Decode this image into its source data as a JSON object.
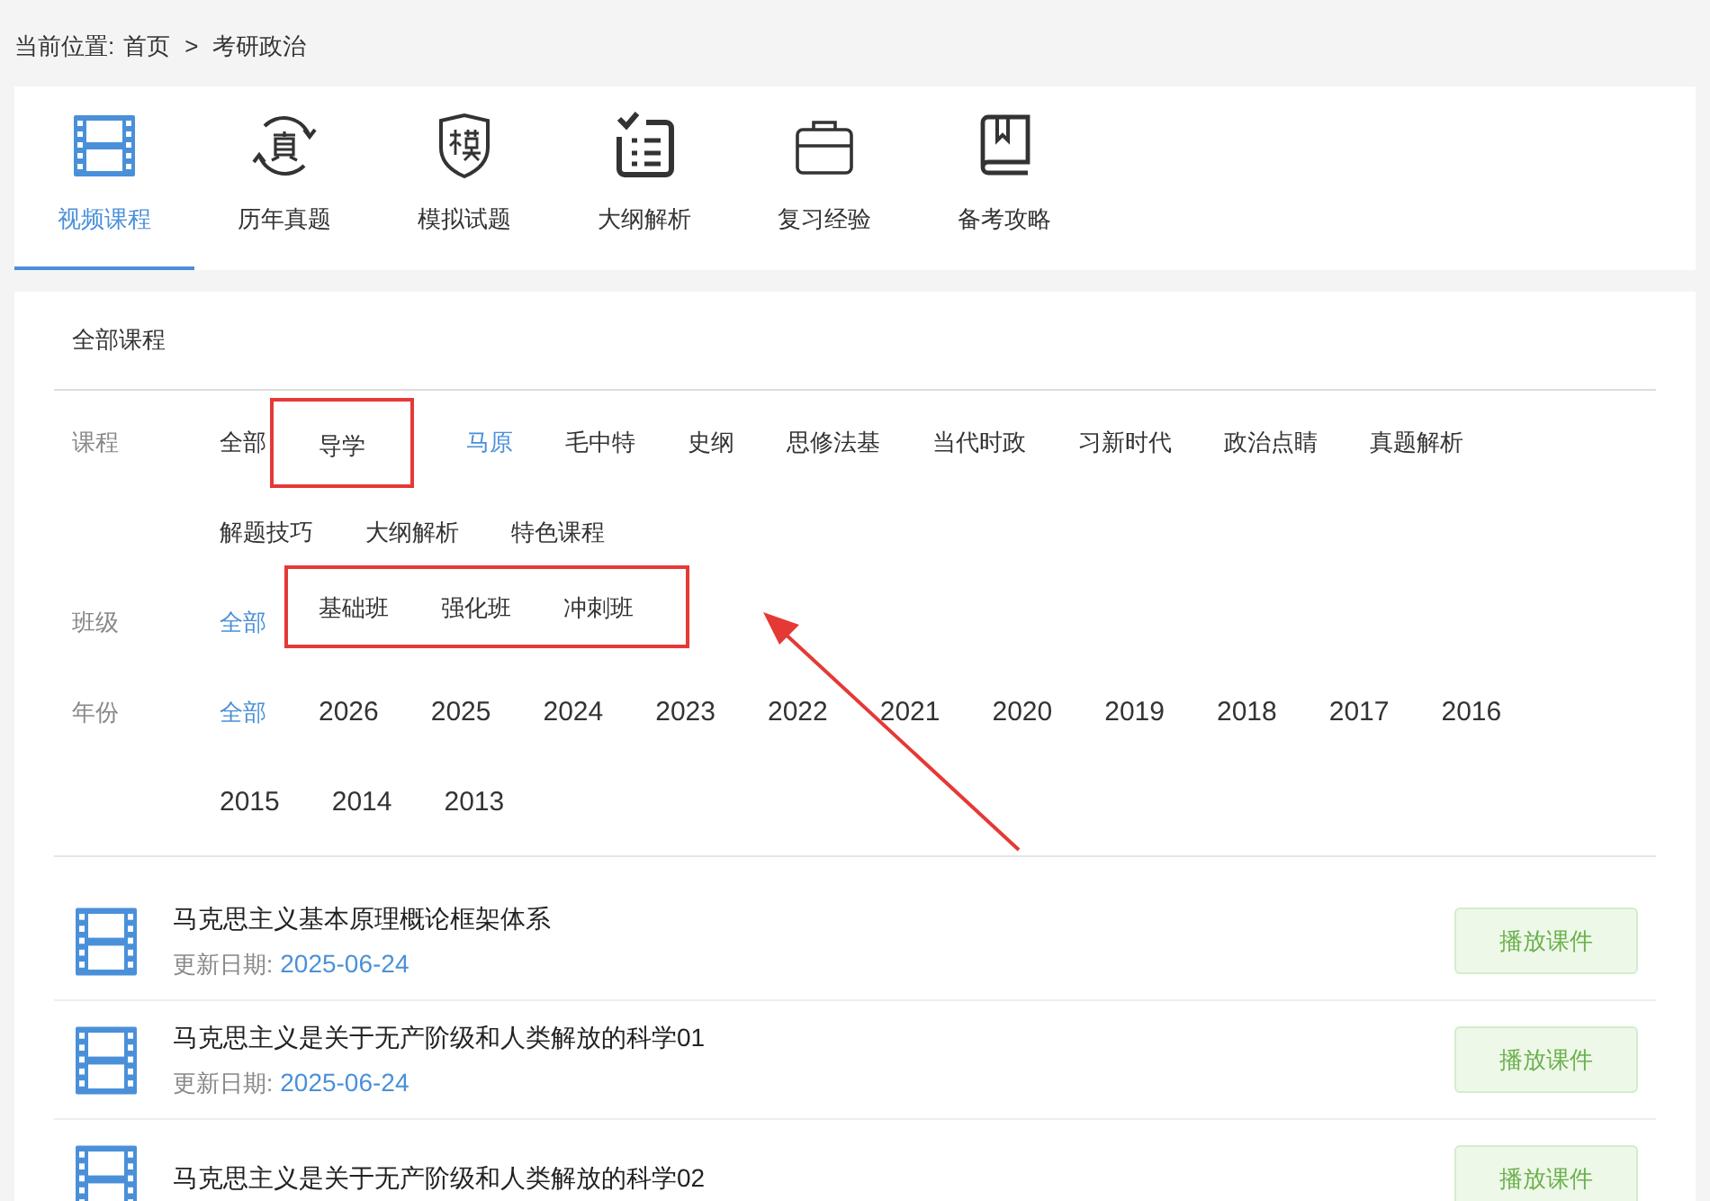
{
  "breadcrumb": {
    "label": "当前位置:",
    "items": [
      "首页",
      "考研政治"
    ],
    "separator": ">"
  },
  "tabs": [
    {
      "label": "视频课程",
      "selected": true
    },
    {
      "label": "历年真题",
      "selected": false
    },
    {
      "label": "模拟试题",
      "selected": false
    },
    {
      "label": "大纲解析",
      "selected": false
    },
    {
      "label": "复习经验",
      "selected": false
    },
    {
      "label": "备考攻略",
      "selected": false
    }
  ],
  "panel_title": "全部课程",
  "filters": [
    {
      "label": "课程",
      "options": [
        {
          "text": "全部",
          "selected": false,
          "boxed": false
        },
        {
          "text": "导学",
          "selected": false,
          "boxed": true
        },
        {
          "text": "马原",
          "selected": true,
          "boxed": false
        },
        {
          "text": "毛中特",
          "selected": false,
          "boxed": false
        },
        {
          "text": "史纲",
          "selected": false,
          "boxed": false
        },
        {
          "text": "思修法基",
          "selected": false,
          "boxed": false
        },
        {
          "text": "当代时政",
          "selected": false,
          "boxed": false
        },
        {
          "text": "习新时代",
          "selected": false,
          "boxed": false
        },
        {
          "text": "政治点睛",
          "selected": false,
          "boxed": false
        },
        {
          "text": "真题解析",
          "selected": false,
          "boxed": false
        },
        {
          "text": "解题技巧",
          "selected": false,
          "boxed": false
        },
        {
          "text": "大纲解析",
          "selected": false,
          "boxed": false
        },
        {
          "text": "特色课程",
          "selected": false,
          "boxed": false
        }
      ]
    },
    {
      "label": "班级",
      "boxed": true,
      "options": [
        {
          "text": "全部",
          "selected": true,
          "boxed": false
        },
        {
          "text": "基础班",
          "selected": false,
          "boxed": false
        },
        {
          "text": "强化班",
          "selected": false,
          "boxed": false
        },
        {
          "text": "冲刺班",
          "selected": false,
          "boxed": false
        }
      ]
    },
    {
      "label": "年份",
      "options": [
        {
          "text": "全部",
          "selected": true,
          "boxed": false
        },
        {
          "text": "2026",
          "selected": false,
          "boxed": false
        },
        {
          "text": "2025",
          "selected": false,
          "boxed": false
        },
        {
          "text": "2024",
          "selected": false,
          "boxed": false
        },
        {
          "text": "2023",
          "selected": false,
          "boxed": false
        },
        {
          "text": "2022",
          "selected": false,
          "boxed": false
        },
        {
          "text": "2021",
          "selected": false,
          "boxed": false
        },
        {
          "text": "2020",
          "selected": false,
          "boxed": false
        },
        {
          "text": "2019",
          "selected": false,
          "boxed": false
        },
        {
          "text": "2018",
          "selected": false,
          "boxed": false
        },
        {
          "text": "2017",
          "selected": false,
          "boxed": false
        },
        {
          "text": "2016",
          "selected": false,
          "boxed": false
        },
        {
          "text": "2015",
          "selected": false,
          "boxed": false
        },
        {
          "text": "2014",
          "selected": false,
          "boxed": false
        },
        {
          "text": "2013",
          "selected": false,
          "boxed": false
        }
      ]
    }
  ],
  "courses": [
    {
      "title": "马克思主义基本原理概论框架体系",
      "date_label": "更新日期:",
      "date": "2025-06-24",
      "button": "播放课件"
    },
    {
      "title": "马克思主义是关于无产阶级和人类解放的科学01",
      "date_label": "更新日期:",
      "date": "2025-06-24",
      "button": "播放课件"
    },
    {
      "title": "马克思主义是关于无产阶级和人类解放的科学02",
      "button": "播放课件"
    }
  ],
  "annotation_arrow": true
}
